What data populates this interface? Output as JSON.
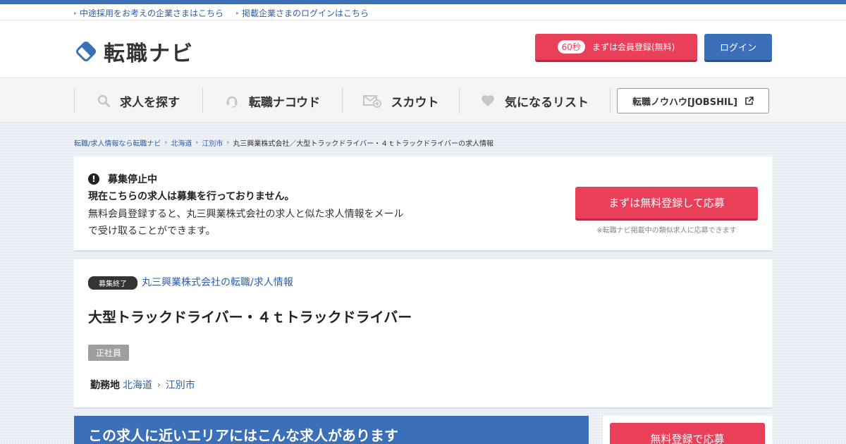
{
  "utility": {
    "link1": "中途採用をお考えの企業さまはこちら",
    "link2": "掲載企業さまのログインはこちら"
  },
  "header": {
    "logo_text": "転職ナビ",
    "register_badge": "60秒",
    "register_label": "まずは会員登録(無料)",
    "login_label": "ログイン"
  },
  "nav": {
    "items": [
      {
        "label": "求人を探す",
        "icon": "search-icon"
      },
      {
        "label": "転職ナコウド",
        "icon": "headset-icon"
      },
      {
        "label": "スカウト",
        "icon": "mail-plus-icon"
      },
      {
        "label": "気になるリスト",
        "icon": "heart-icon"
      }
    ],
    "external_label": "転職ノウハウ[JOBSHIL]"
  },
  "breadcrumb": {
    "items": [
      "転職/求人情報なら転職ナビ",
      "北海道",
      "江別市"
    ],
    "current": "丸三興業株式会社／大型トラックドライバー・４ｔトラックドライバーの求人情報"
  },
  "notice": {
    "heading": "募集停止中",
    "bold": "現在こちらの求人は募集を行っておりません。",
    "body": "無料会員登録すると、丸三興業株式会社の求人と似た求人情報をメールで受け取ることができます。",
    "apply_label": "まずは無料登録して応募",
    "apply_note": "※転職ナビ掲載中の類似求人に応募できます"
  },
  "job": {
    "status_tag": "募集終了",
    "company_link": "丸三興業株式会社の転職/求人情報",
    "title": "大型トラックドライバー・４ｔトラックドライバー",
    "employment_type": "正社員",
    "location_label": "勤務地",
    "prefecture": "北海道",
    "city": "江別市"
  },
  "area": {
    "heading": "この求人に近いエリアにはこんな求人があります",
    "side_button": "無料登録で応募"
  },
  "colors": {
    "brand_blue": "#3b6fb8",
    "accent_red": "#ea3f59",
    "link_blue": "#2f5ea8"
  }
}
